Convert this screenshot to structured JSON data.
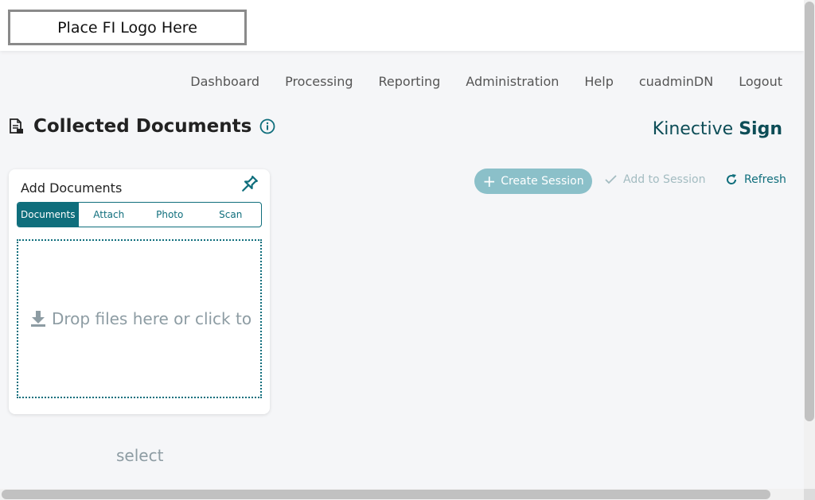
{
  "header": {
    "logo_text": "Place FI Logo Here"
  },
  "nav": {
    "items": [
      "Dashboard",
      "Processing",
      "Reporting",
      "Administration",
      "Help",
      "cuadminDN",
      "Logout"
    ]
  },
  "page": {
    "title": "Collected Documents",
    "brand_light": "Kinective",
    "brand_bold": "Sign"
  },
  "add_documents": {
    "title": "Add Documents",
    "tabs": [
      "Documents",
      "Attach",
      "Photo",
      "Scan"
    ],
    "active_tab": "Documents",
    "drop_text": "Drop files here or click to",
    "select_text": "select"
  },
  "actions": {
    "create_session": "Create Session",
    "add_to_session": "Add to Session",
    "refresh": "Refresh"
  },
  "colors": {
    "accent": "#0f6e7c",
    "accent_light": "#8bc0c9",
    "muted_text": "#8d9ca3"
  }
}
